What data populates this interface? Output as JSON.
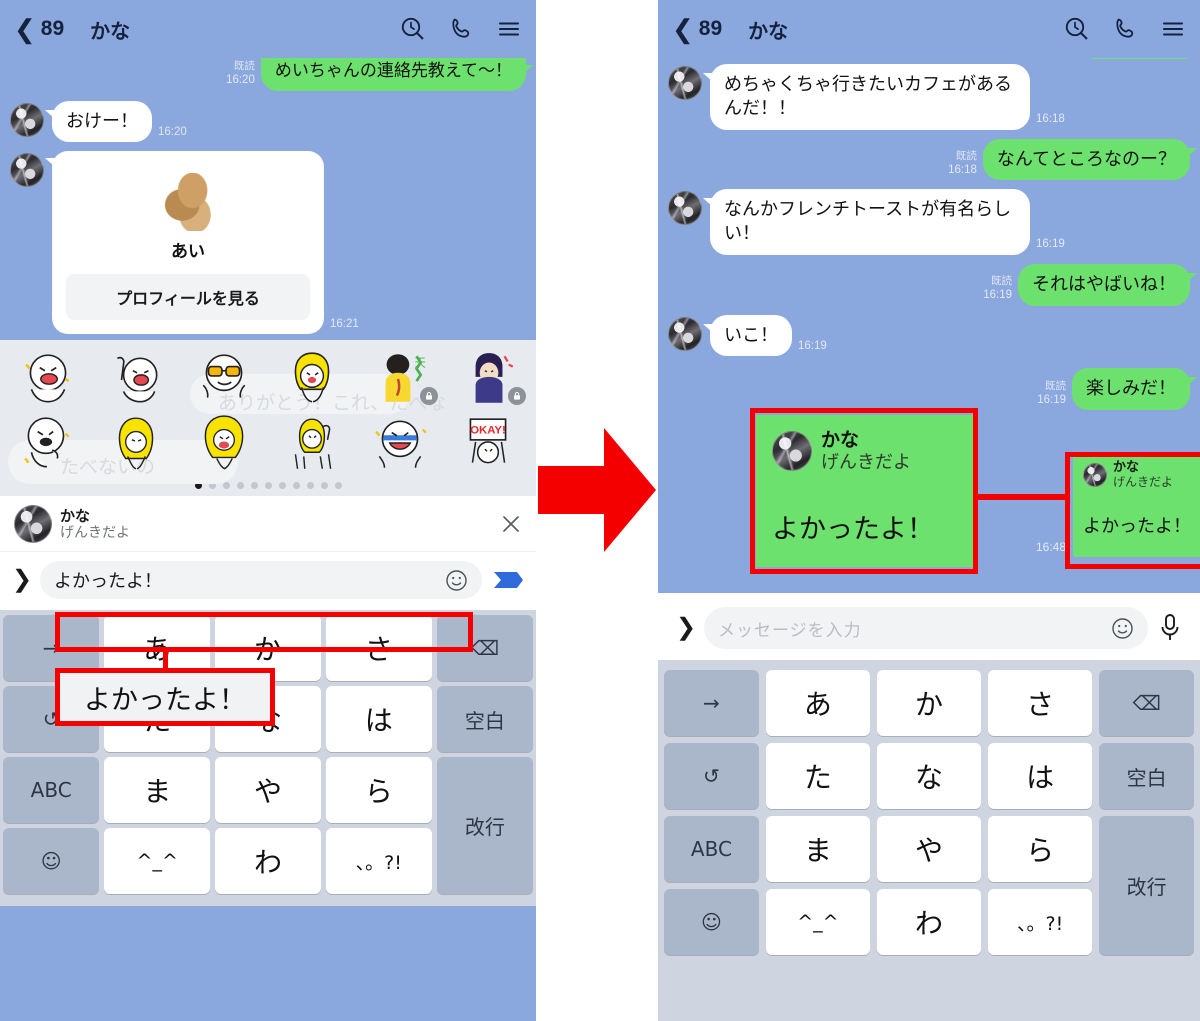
{
  "left": {
    "header": {
      "back_icon": "chevron-left-icon",
      "member_count": "89",
      "title": "かな",
      "search_icon": "search-clock-icon",
      "call_icon": "phone-icon",
      "menu_icon": "hamburger-menu-icon"
    },
    "messages": [
      {
        "side": "out",
        "text": "めいちゃんの連絡先教えて〜！",
        "time": "16:20",
        "read": "既読",
        "clipped": true
      },
      {
        "side": "in",
        "text": "おけー！",
        "time": "16:20"
      }
    ],
    "profile_card": {
      "name": "あい",
      "button_label": "プロフィールを見る",
      "time": "16:21"
    },
    "sticker_panel": {
      "ghost_text_1": "ありがとう！これ、たべな",
      "ghost_text_2": "たべないの",
      "page_dots_total": 11,
      "page_dots_active": 1
    },
    "preview": {
      "name": "かな",
      "status": "げんきだよ",
      "close_icon": "close-icon"
    },
    "input": {
      "expand_icon": "chevron-right-icon",
      "value": "よかったよ！",
      "emoji_icon": "smiley-icon",
      "send_icon": "send-paperplane-icon"
    },
    "callout_text": "よかったよ！",
    "keyboard": {
      "rows": [
        [
          {
            "label": "→",
            "type": "fn",
            "name": "cursor-right-key"
          },
          {
            "label": "あ",
            "type": "char",
            "name": "key-a"
          },
          {
            "label": "か",
            "type": "char",
            "name": "key-ka"
          },
          {
            "label": "さ",
            "type": "char",
            "name": "key-sa"
          },
          {
            "label": "⌫",
            "type": "fn",
            "name": "backspace-key"
          }
        ],
        [
          {
            "label": "↺",
            "type": "fn",
            "name": "undo-key"
          },
          {
            "label": "た",
            "type": "char",
            "name": "key-ta"
          },
          {
            "label": "な",
            "type": "char",
            "name": "key-na"
          },
          {
            "label": "は",
            "type": "char",
            "name": "key-ha"
          },
          {
            "label": "空白",
            "type": "fn",
            "name": "space-key"
          }
        ],
        [
          {
            "label": "ABC",
            "type": "fn",
            "name": "abc-key"
          },
          {
            "label": "ま",
            "type": "char",
            "name": "key-ma"
          },
          {
            "label": "や",
            "type": "char",
            "name": "key-ya"
          },
          {
            "label": "ら",
            "type": "char",
            "name": "key-ra"
          },
          {
            "label": "改行",
            "type": "fn",
            "name": "enter-key"
          }
        ],
        [
          {
            "label": "☺",
            "type": "fn",
            "name": "emoji-key"
          },
          {
            "label": "^_^",
            "type": "char",
            "name": "key-kaomoji"
          },
          {
            "label": "わ",
            "type": "char",
            "name": "key-wa"
          },
          {
            "label": "、。?!",
            "type": "char",
            "name": "key-punctuation"
          }
        ]
      ]
    }
  },
  "right": {
    "header": {
      "back_icon": "chevron-left-icon",
      "member_count": "89",
      "title": "かな",
      "search_icon": "search-clock-icon",
      "call_icon": "phone-icon",
      "menu_icon": "hamburger-menu-icon"
    },
    "messages": [
      {
        "side": "in",
        "text": "めちゃくちゃ行きたいカフェがあるんだ！！",
        "time": "16:18"
      },
      {
        "side": "out",
        "text": "なんてところなのー？",
        "time": "16:18",
        "read": "既読"
      },
      {
        "side": "in",
        "text": "なんかフレンチトーストが有名らしい！",
        "time": "16:19"
      },
      {
        "side": "out",
        "text": "それはやばいね！",
        "time": "16:19",
        "read": "既読"
      },
      {
        "side": "in",
        "text": "いこ！",
        "time": "16:19"
      },
      {
        "side": "out",
        "text": "楽しみだ！",
        "time": "16:19",
        "read": "既読"
      }
    ],
    "quoted_sticker": {
      "name": "かな",
      "status": "げんきだよ",
      "text": "よかったよ！",
      "time": "16:48"
    },
    "zoom_callout": {
      "name": "かな",
      "status": "げんきだよ",
      "text": "よかったよ！"
    },
    "input": {
      "expand_icon": "chevron-right-icon",
      "placeholder": "メッセージを入力",
      "emoji_icon": "smiley-icon",
      "mic_icon": "microphone-icon"
    },
    "keyboard": {
      "rows": [
        [
          {
            "label": "→",
            "type": "fn",
            "name": "cursor-right-key"
          },
          {
            "label": "あ",
            "type": "char",
            "name": "key-a"
          },
          {
            "label": "か",
            "type": "char",
            "name": "key-ka"
          },
          {
            "label": "さ",
            "type": "char",
            "name": "key-sa"
          },
          {
            "label": "⌫",
            "type": "fn",
            "name": "backspace-key"
          }
        ],
        [
          {
            "label": "↺",
            "type": "fn",
            "name": "undo-key"
          },
          {
            "label": "た",
            "type": "char",
            "name": "key-ta"
          },
          {
            "label": "な",
            "type": "char",
            "name": "key-na"
          },
          {
            "label": "は",
            "type": "char",
            "name": "key-ha"
          },
          {
            "label": "空白",
            "type": "fn",
            "name": "space-key"
          }
        ],
        [
          {
            "label": "ABC",
            "type": "fn",
            "name": "abc-key"
          },
          {
            "label": "ま",
            "type": "char",
            "name": "key-ma"
          },
          {
            "label": "や",
            "type": "char",
            "name": "key-ya"
          },
          {
            "label": "ら",
            "type": "char",
            "name": "key-ra"
          },
          {
            "label": "改行",
            "type": "fn",
            "name": "enter-key"
          }
        ],
        [
          {
            "label": "☺",
            "type": "fn",
            "name": "emoji-key"
          },
          {
            "label": "^_^",
            "type": "char",
            "name": "key-kaomoji"
          },
          {
            "label": "わ",
            "type": "char",
            "name": "key-wa"
          },
          {
            "label": "、。?!",
            "type": "char",
            "name": "key-punctuation"
          }
        ]
      ]
    }
  },
  "annotations": {
    "flow_arrow": "red-right-arrow",
    "colors": {
      "highlight": "#f40000",
      "chat_background": "#8aa8dd",
      "outgoing_bubble": "#6de16d",
      "incoming_bubble": "#ffffff",
      "keyboard_background": "#ced5e0",
      "keyboard_function_key": "#aab6ca"
    }
  }
}
